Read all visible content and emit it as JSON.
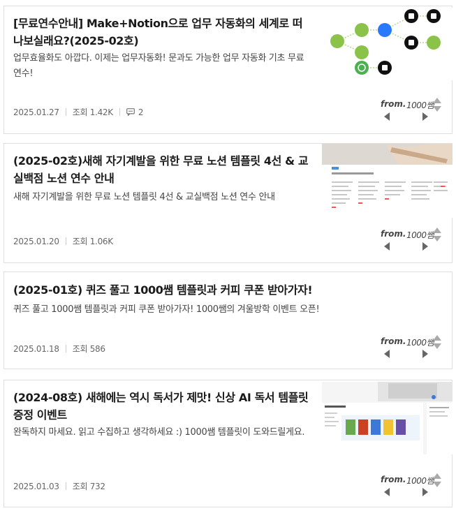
{
  "posts": [
    {
      "title": "[무료연수안내] Make+Notion으로 업무 자동화의 세계로 떠나보실래요?(2025-02호)",
      "description": "업무효율화도 아깝다. 이제는 업무자동화! 문과도 가능한 업무 자동화 기초 무료연수!",
      "date": "2025.01.27",
      "views": "조회 1.42K",
      "comments": "2",
      "price_from": "from.",
      "price_amount": "1000쌤"
    },
    {
      "title": "(2025-02호)새해 자기계발을 위한 무료 노션 템플릿 4선 & 교실백점 노션 연수 안내",
      "description": "새해 자기계발을 위한 무료 노션 템플릿 4선 & 교실백점 노션 연수 안내",
      "date": "2025.01.20",
      "views": "조회 1.06K",
      "price_from": "from.",
      "price_amount": "1000쌤"
    },
    {
      "title": "(2025-01호) 퀴즈 풀고 1000쌤 템플릿과 커피 쿠폰 받아가자!",
      "description": "퀴즈 풀고 1000쌤 템플릿과 커피 쿠폰 받아가자! 1000쌤의 겨울방학 이벤트 오픈!",
      "date": "2025.01.18",
      "views": "조회 586",
      "price_from": "from.",
      "price_amount": "1000쌤"
    },
    {
      "title": "(2024-08호) 새해에는 역시 독서가 제맛! 신상 AI 독서 템플릿 증정 이벤트",
      "description": "완독하지 마세요. 읽고 수집하고 생각하세요 :) 1000쌤 템플릿이 도와드릴게요.",
      "date": "2025.01.03",
      "views": "조회 732",
      "price_from": "from.",
      "price_amount": "1000쌤"
    }
  ]
}
